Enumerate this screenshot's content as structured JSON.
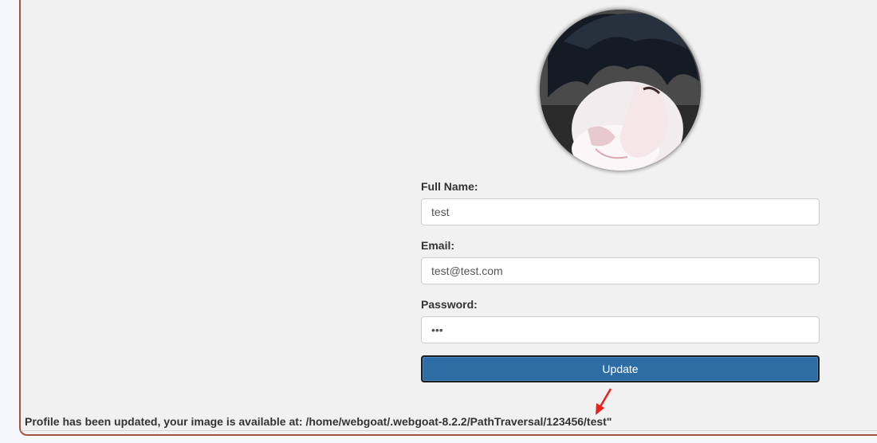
{
  "form": {
    "full_name_label": "Full Name:",
    "full_name_value": "test",
    "email_label": "Email:",
    "email_value": "test@test.com",
    "password_label": "Password:",
    "password_value": "•••",
    "update_label": "Update"
  },
  "status": {
    "message": "Profile has been updated, your image is available at: /home/webgoat/.webgoat-8.2.2/PathTraversal/123456/test\""
  },
  "colors": {
    "button": "#2e6da4",
    "panel_border": "#a5514a",
    "annotation_arrow": "#e8221b"
  }
}
